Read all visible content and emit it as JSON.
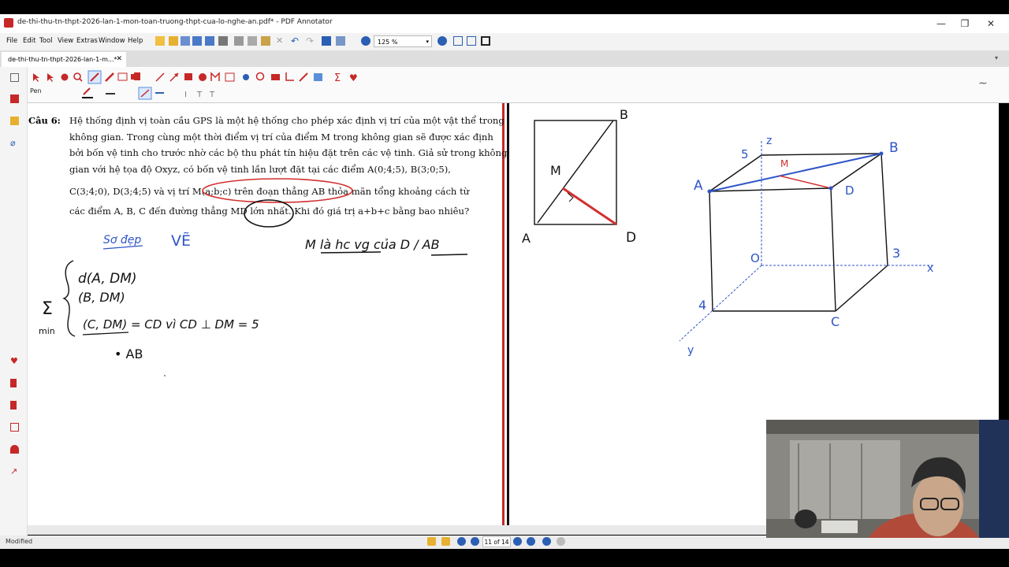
{
  "window": {
    "title": "de-thi-thu-tn-thpt-2026-lan-1-mon-toan-truong-thpt-cua-lo-nghe-an.pdf* - PDF Annotator",
    "controls": [
      "—",
      "❐",
      "✕"
    ]
  },
  "menu": [
    "File",
    "Edit",
    "Tool",
    "View",
    "Extras",
    "Window",
    "Help"
  ],
  "toolbar": {
    "zoom": "125 %"
  },
  "tab": {
    "label": "de-thi-thu-tn-thpt-2026-lan-1-m...*",
    "close": "✕"
  },
  "annotation_toolbar": {
    "tool_name": "Pen"
  },
  "question": {
    "label": "Câu 6:",
    "lines": [
      "Hệ thống định vị toàn cầu  GPS  là một hệ thống cho phép xác định vị trí của một vật thể trong",
      "không gian. Trong cùng một thời điểm vị trí của điểm  M  trong không gian sẽ được xác định",
      "bởi bốn vệ tinh cho trước nhờ các bộ thu phát tín hiệu đặt trên các vệ tinh. Giả sử trong không",
      "gian  với  hệ  tọa  độ  Oxyz, có  bốn  vệ  tinh  lần  lượt  đặt  tại  các  điểm   A(0;4;5), B(3;0;5),",
      "C(3;4;0),  D(3;4;5)  và vị trí  M(a;b;c)  trên đoạn thẳng  AB  thỏa mãn tổng khoảng cách từ",
      "các điểm  A, B, C  đến đường thẳng  MD  lớn nhất. Khi đó giá trị  a+b+c  bằng bao nhiêu?"
    ]
  },
  "handwriting": {
    "so_dep": "Sơ đẹp",
    "ve": "VẼ",
    "m_note": "M là hc vg của D / AB",
    "d_line": "d(A, DM)",
    "b_line": "(B, DM)",
    "c_line": "(C, DM) = CD vì CD ⊥ DM = 5",
    "sum": "Σ",
    "min": "min",
    "ab": "• AB",
    "fig1": {
      "A": "A",
      "B": "B",
      "D": "D",
      "M": "M"
    },
    "fig2": {
      "A": "A",
      "B": "B",
      "C": "C",
      "D": "D",
      "M": "M",
      "O": "O",
      "x": "x",
      "y": "y",
      "z": "z",
      "n5": "5",
      "n3": "3",
      "n4": "4"
    }
  },
  "status": {
    "text": "Modified",
    "page": "11 of 14"
  }
}
